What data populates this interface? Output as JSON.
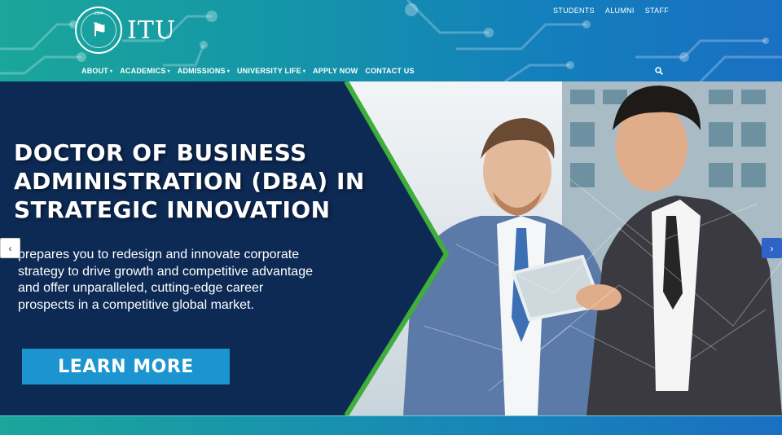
{
  "brand": {
    "name": "ITU",
    "seal_year": "1994"
  },
  "top_links": [
    "STUDENTS",
    "ALUMNI",
    "STAFF"
  ],
  "main_nav": [
    {
      "label": "ABOUT",
      "dropdown": true
    },
    {
      "label": "ACADEMICS",
      "dropdown": true
    },
    {
      "label": "ADMISSIONS",
      "dropdown": true
    },
    {
      "label": "UNIVERSITY LIFE",
      "dropdown": true
    },
    {
      "label": "APPLY NOW",
      "dropdown": false
    },
    {
      "label": "CONTACT US",
      "dropdown": false
    }
  ],
  "hero": {
    "headline": [
      "DOCTOR OF BUSINESS",
      "ADMINISTRATION (DBA) IN",
      "STRATEGIC INNOVATION"
    ],
    "description": [
      "prepares you to redesign and innovate corporate",
      "strategy to drive growth and competitive advantage",
      "and offer unparalleled, cutting-edge career",
      "prospects in a competitive global market."
    ],
    "cta_label": "LEARN MORE",
    "prev_arrow": "‹",
    "next_arrow": "›"
  },
  "icons": {
    "search": "search-icon",
    "seal": "university-seal-icon"
  },
  "colors": {
    "panel_navy": "#0d2a55",
    "accent_green": "#3fae3a",
    "cta_blue": "#1b94d0",
    "header_teal": "#1aa69a",
    "header_blue": "#1a6fc2"
  }
}
